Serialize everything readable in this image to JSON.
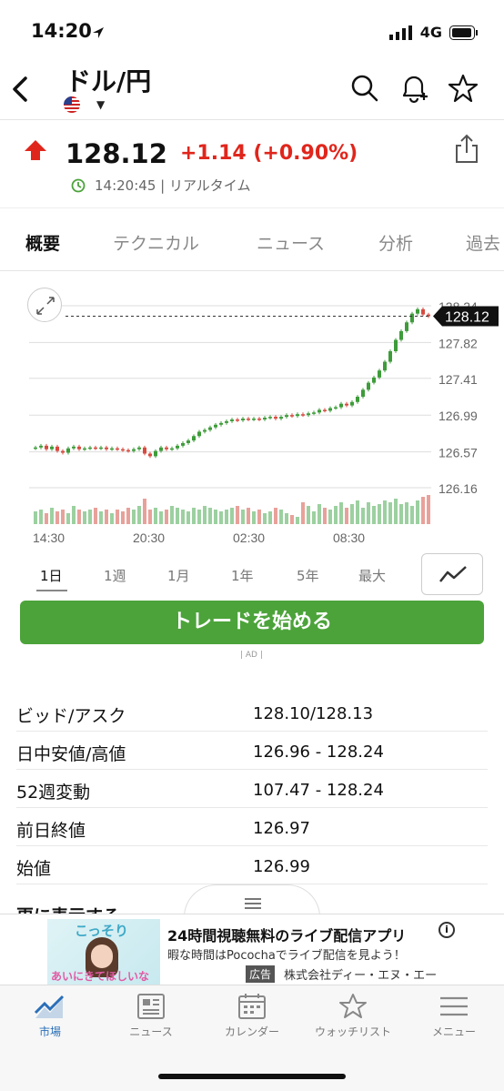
{
  "status_bar": {
    "time": "14:20",
    "network": "4G"
  },
  "header": {
    "title": "ドル/円"
  },
  "quote": {
    "price": "128.12",
    "change": "+1.14 (+0.90%)",
    "timestamp": "14:20:45 | リアルタイム",
    "up_color": "#e0261c"
  },
  "tabs": [
    {
      "label": "概要"
    },
    {
      "label": "テクニカル"
    },
    {
      "label": "ニュース"
    },
    {
      "label": "分析"
    },
    {
      "label": "過去"
    }
  ],
  "chart_data": {
    "type": "candlestick",
    "y_ticks": [
      "128.24",
      "127.82",
      "127.41",
      "126.99",
      "126.57",
      "126.16"
    ],
    "x_ticks": [
      "14:30",
      "20:30",
      "02:30",
      "08:30"
    ],
    "current_price_label": "128.12",
    "ylim": [
      126.16,
      128.24
    ],
    "close_series": [
      126.62,
      126.64,
      126.6,
      126.63,
      126.58,
      126.56,
      126.61,
      126.63,
      126.6,
      126.61,
      126.62,
      126.61,
      126.62,
      126.6,
      126.61,
      126.6,
      126.59,
      126.58,
      126.6,
      126.62,
      126.55,
      126.52,
      126.58,
      126.62,
      126.6,
      126.61,
      126.64,
      126.67,
      126.7,
      126.75,
      126.8,
      126.82,
      126.85,
      126.88,
      126.9,
      126.92,
      126.94,
      126.93,
      126.95,
      126.94,
      126.95,
      126.94,
      126.96,
      126.97,
      126.95,
      126.97,
      126.99,
      126.98,
      127.0,
      126.99,
      127.01,
      127.02,
      127.05,
      127.04,
      127.07,
      127.08,
      127.12,
      127.1,
      127.14,
      127.2,
      127.28,
      127.36,
      127.42,
      127.5,
      127.6,
      127.72,
      127.85,
      127.95,
      128.05,
      128.15,
      128.2,
      128.14,
      128.12
    ],
    "volume_series": [
      7,
      8,
      6,
      9,
      7,
      8,
      6,
      10,
      8,
      7,
      8,
      9,
      7,
      8,
      6,
      8,
      7,
      9,
      8,
      10,
      14,
      8,
      9,
      7,
      8,
      10,
      9,
      8,
      7,
      9,
      8,
      10,
      9,
      8,
      7,
      8,
      9,
      10,
      8,
      9,
      7,
      8,
      6,
      7,
      9,
      8,
      6,
      5,
      4,
      12,
      10,
      7,
      11,
      9,
      8,
      10,
      12,
      9,
      11,
      13,
      9,
      12,
      10,
      11,
      13,
      12,
      14,
      11,
      12,
      10,
      13,
      15,
      16
    ],
    "up_color": "#3e9c3a",
    "down_color": "#d84a3f"
  },
  "periods": [
    {
      "label": "1日"
    },
    {
      "label": "1週"
    },
    {
      "label": "1月"
    },
    {
      "label": "1年"
    },
    {
      "label": "5年"
    },
    {
      "label": "最大"
    }
  ],
  "trade_button": {
    "label": "トレードを始める",
    "color": "#4ca33a"
  },
  "ad_marker": "| AD |",
  "stats": [
    {
      "label": "ビッド/アスク",
      "value": "128.10/128.13"
    },
    {
      "label": "日中安値/高値",
      "value": "126.96 - 128.24"
    },
    {
      "label": "52週変動",
      "value": "107.47 - 128.24"
    },
    {
      "label": "前日終値",
      "value": "126.97"
    },
    {
      "label": "始値",
      "value": "126.99"
    }
  ],
  "more_link": "更に表示する",
  "ad_banner": {
    "title": "24時間視聴無料のライブ配信アプリ",
    "subtitle": "暇な時間はPocochaでライブ配信を見よう！",
    "tag": "広告",
    "company": "株式会社ディー・エヌ・エー",
    "thumb_text_top": "こっそり",
    "thumb_text_bottom": "あいにきてほしいな"
  },
  "bottom_nav": [
    {
      "label": "市場",
      "icon": "market-chart-icon"
    },
    {
      "label": "ニュース",
      "icon": "newspaper-icon"
    },
    {
      "label": "カレンダー",
      "icon": "calendar-icon"
    },
    {
      "label": "ウォッチリスト",
      "icon": "star-icon"
    },
    {
      "label": "メニュー",
      "icon": "hamburger-icon"
    }
  ]
}
